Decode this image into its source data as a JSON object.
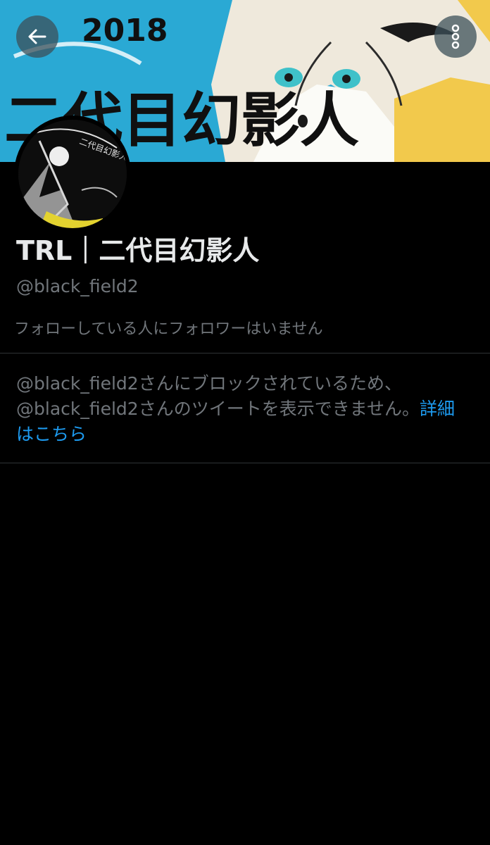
{
  "header": {
    "back_icon": "arrow-left-icon",
    "more_icon": "vertical-dots-icon",
    "banner_text": {
      "year": "2018",
      "title": "二代目幻影人"
    }
  },
  "profile": {
    "avatar_text": "二代目幻影人",
    "display_name": "TRL｜二代目幻影人",
    "handle": "@black_field2",
    "follow_note": "フォローしている人にフォロワーはいません"
  },
  "blocked": {
    "message": "@black_field2さんにブロックされているため、@black_field2さんのツイートを表示できません。",
    "learn_more": "詳細はこちら"
  },
  "colors": {
    "background": "#000000",
    "banner_bg": "#2aa9d4",
    "link": "#1d9bf0",
    "muted_text": "#71767b",
    "divider": "#2f3336"
  }
}
